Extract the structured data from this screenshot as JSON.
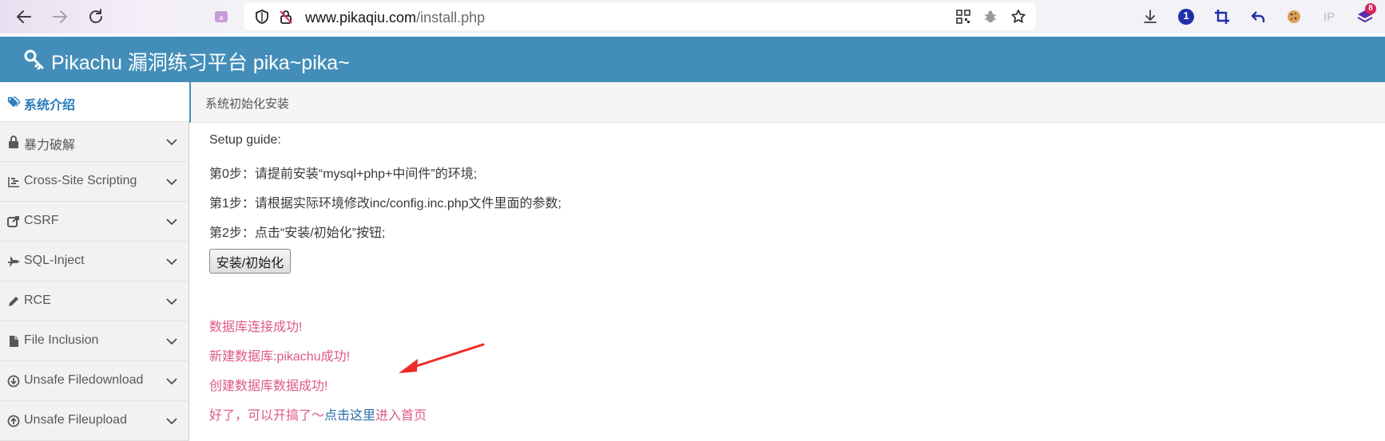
{
  "browser": {
    "url_host": "www.pikaqiu.com",
    "url_path": "/install.php",
    "extension_badge": "8",
    "extension_number": "1",
    "ip_label": "IP"
  },
  "header": {
    "title": "Pikachu 漏洞练习平台 pika~pika~"
  },
  "sidebar": {
    "items": [
      {
        "label": "系统介绍",
        "icon": "tags-icon",
        "active": true
      },
      {
        "label": "暴力破解",
        "icon": "lock-icon"
      },
      {
        "label": "Cross-Site Scripting",
        "icon": "list-icon"
      },
      {
        "label": "CSRF",
        "icon": "share-icon"
      },
      {
        "label": "SQL-Inject",
        "icon": "fighter-jet-icon"
      },
      {
        "label": "RCE",
        "icon": "pencil-icon"
      },
      {
        "label": "File Inclusion",
        "icon": "file-icon"
      },
      {
        "label": "Unsafe Filedownload",
        "icon": "download-icon"
      },
      {
        "label": "Unsafe Fileupload",
        "icon": "upload-icon"
      }
    ]
  },
  "main": {
    "breadcrumb": "系统初始化安装",
    "setup_title": "Setup guide:",
    "steps": [
      "第0步：请提前安装“mysql+php+中间件”的环境;",
      "第1步：请根据实际环境修改inc/config.inc.php文件里面的参数;",
      "第2步：点击“安装/初始化”按钮;"
    ],
    "install_button": "安装/初始化",
    "messages": [
      "数据库连接成功!",
      "新建数据库:pikachu成功!",
      "创建数据库数据成功!"
    ],
    "final_prefix": "好了，可以开搞了～",
    "final_link": "点击这里",
    "final_suffix": "进入首页"
  },
  "colors": {
    "header_bg": "#438eb9",
    "message": "#dd5a82",
    "link": "#2a6ea8",
    "arrow": "#ee2a24"
  }
}
